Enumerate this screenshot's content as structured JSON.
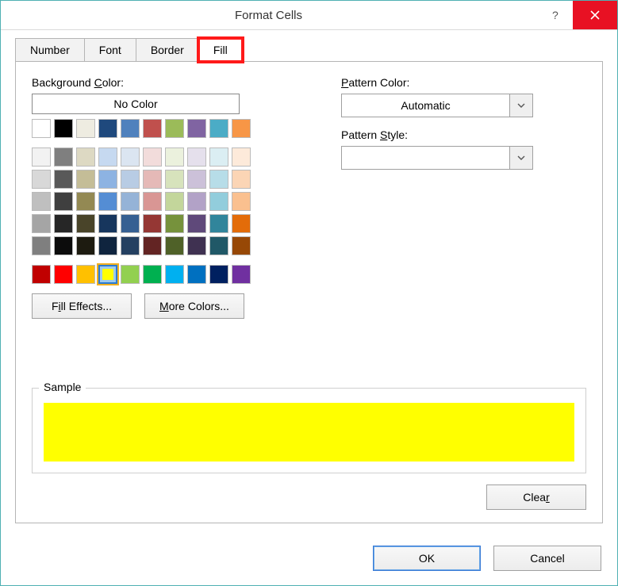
{
  "window": {
    "title": "Format Cells"
  },
  "tabs": {
    "number": "Number",
    "font": "Font",
    "border": "Border",
    "fill": "Fill",
    "active": "fill",
    "highlighted": "fill"
  },
  "fill": {
    "bg_label_pre": "Background ",
    "bg_label_u": "C",
    "bg_label_post": "olor:",
    "no_color": "No Color",
    "theme_row": [
      "#ffffff",
      "#000000",
      "#eeece1",
      "#1f497d",
      "#4f81bd",
      "#c0504d",
      "#9bbb59",
      "#8064a2",
      "#4bacc6",
      "#f79646"
    ],
    "palette": [
      "#f2f2f2",
      "#7f7f7f",
      "#ddd9c3",
      "#c6d9f0",
      "#dbe5f1",
      "#f2dcdb",
      "#ebf1dd",
      "#e5e0ec",
      "#dbeef3",
      "#fdeada",
      "#d8d8d8",
      "#595959",
      "#c4bd97",
      "#8db3e2",
      "#b8cce4",
      "#e5b9b7",
      "#d7e3bc",
      "#ccc1d9",
      "#b7dde8",
      "#fbd5b5",
      "#bfbfbf",
      "#3f3f3f",
      "#938953",
      "#548dd4",
      "#95b3d7",
      "#d99694",
      "#c3d69b",
      "#b2a2c7",
      "#92cddc",
      "#fac08f",
      "#a5a5a5",
      "#262626",
      "#494429",
      "#17365d",
      "#366092",
      "#953734",
      "#76923c",
      "#5f497a",
      "#31859b",
      "#e36c09",
      "#7f7f7f",
      "#0c0c0c",
      "#1d1b10",
      "#0f243e",
      "#244061",
      "#632423",
      "#4f6128",
      "#3f3151",
      "#205867",
      "#974806"
    ],
    "standard": [
      "#c00000",
      "#ff0000",
      "#ffc000",
      "#ffff00",
      "#92d050",
      "#00b050",
      "#00b0f0",
      "#0070c0",
      "#002060",
      "#7030a0"
    ],
    "selected_color": "#ffff00",
    "fill_effects_pre": "F",
    "fill_effects_u": "i",
    "fill_effects_post": "ll Effects...",
    "more_colors_u": "M",
    "more_colors_post": "ore Colors..."
  },
  "pattern": {
    "color_label_u": "P",
    "color_label_post": "attern Color:",
    "color_value": "Automatic",
    "style_label_pre": "Pattern ",
    "style_label_u": "S",
    "style_label_post": "tyle:",
    "style_value": ""
  },
  "sample": {
    "label": "Sample",
    "color": "#ffff00"
  },
  "buttons": {
    "clear_pre": "Clea",
    "clear_u": "r",
    "ok": "OK",
    "cancel": "Cancel"
  }
}
